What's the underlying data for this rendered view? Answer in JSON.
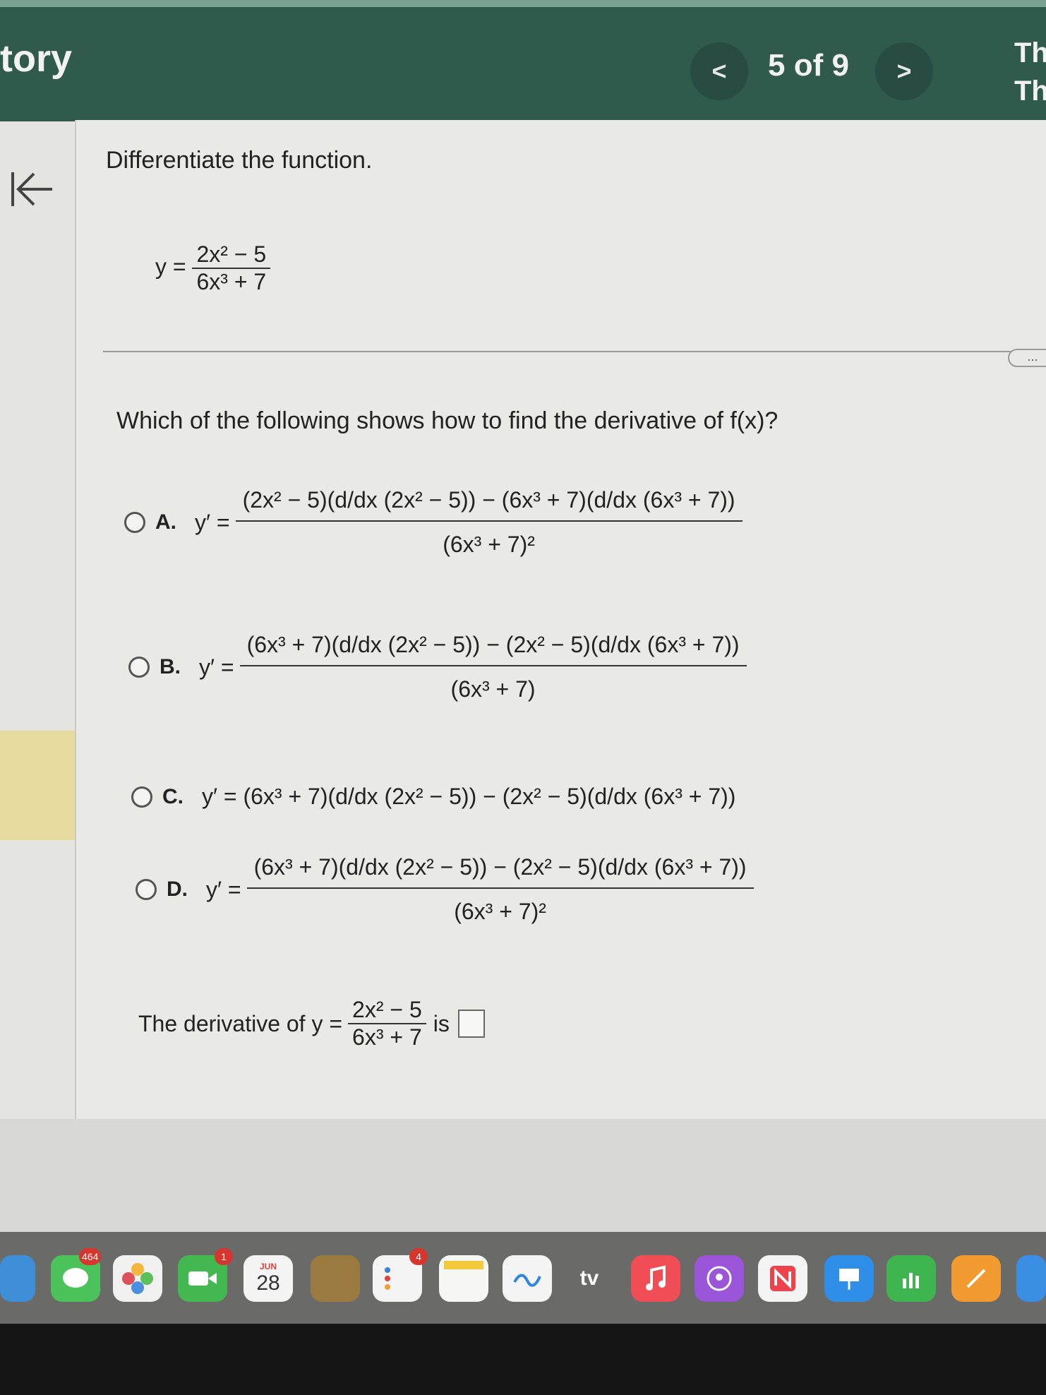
{
  "header": {
    "app_title": "tory",
    "prev_label": "<",
    "counter": "5 of 9",
    "next_label": ">",
    "right_title": "Th\nTh"
  },
  "problem": {
    "instruction": "Differentiate the function.",
    "function": {
      "lhs": "y =",
      "num": "2x² − 5",
      "den": "6x³ + 7"
    }
  },
  "more_button": "...",
  "question": "Which of the following shows how to find the derivative of f(x)?",
  "options": [
    {
      "letter": "A.",
      "lhs": "y′ =",
      "num": "(2x² − 5)(d/dx (2x² − 5)) − (6x³ + 7)(d/dx (6x³ + 7))",
      "den": "(6x³ + 7)²"
    },
    {
      "letter": "B.",
      "lhs": "y′ =",
      "num": "(6x³ + 7)(d/dx (2x² − 5)) − (2x² − 5)(d/dx (6x³ + 7))",
      "den": "(6x³ + 7)"
    },
    {
      "letter": "C.",
      "expr": "y′ = (6x³ + 7)(d/dx (2x² − 5)) − (2x² − 5)(d/dx (6x³ + 7))"
    },
    {
      "letter": "D.",
      "lhs": "y′ =",
      "num": "(6x³ + 7)(d/dx (2x² − 5)) − (2x² − 5)(d/dx (6x³ + 7))",
      "den": "(6x³ + 7)²"
    }
  ],
  "answer": {
    "prefix": "The derivative of y =",
    "num": "2x² − 5",
    "den": "6x³ + 7",
    "suffix": "is"
  },
  "dock": {
    "messages_badge": "464",
    "facetime_badge": "1",
    "calendar_month": "JUN",
    "calendar_day": "28",
    "reminders_badge": "4",
    "tv_label": "tv"
  }
}
